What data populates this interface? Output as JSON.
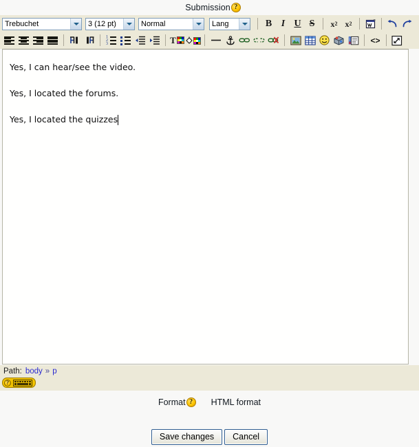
{
  "page": {
    "submission_label": "Submission",
    "help_icon": "question-help-icon",
    "background_color": "#f8f8f7",
    "toolbar_color": "#ece9d8"
  },
  "editor": {
    "toolbar_row1": {
      "font_family": {
        "value": "Trebuchet",
        "name": "font-family-select"
      },
      "font_size": {
        "value": "3 (12 pt)",
        "name": "font-size-select"
      },
      "paragraph_format": {
        "value": "Normal",
        "name": "paragraph-format-select"
      },
      "language": {
        "value": "Lang",
        "name": "language-select"
      },
      "buttons": [
        {
          "name": "bold-button",
          "label": "B",
          "title": "Bold"
        },
        {
          "name": "italic-button",
          "label": "I",
          "title": "Italic"
        },
        {
          "name": "underline-button",
          "label": "U",
          "title": "Underline"
        },
        {
          "name": "strikethrough-button",
          "label": "S",
          "title": "Strikethrough"
        },
        {
          "name": "subscript-button",
          "label": "x2",
          "title": "Subscript"
        },
        {
          "name": "superscript-button",
          "label": "x2",
          "title": "Superscript"
        },
        {
          "name": "clean-word-html-button",
          "label": "",
          "title": "Clean Word HTML"
        },
        {
          "name": "undo-button",
          "label": "",
          "title": "Undo"
        },
        {
          "name": "redo-button",
          "label": "",
          "title": "Redo"
        }
      ]
    },
    "toolbar_row2": {
      "buttons": [
        {
          "name": "align-left-button",
          "title": "Align left"
        },
        {
          "name": "align-center-button",
          "title": "Align center"
        },
        {
          "name": "align-right-button",
          "title": "Align right"
        },
        {
          "name": "align-justify-button",
          "title": "Justify"
        },
        {
          "name": "direction-ltr-button",
          "title": "Left to right"
        },
        {
          "name": "direction-rtl-button",
          "title": "Right to left"
        },
        {
          "name": "numbered-list-button",
          "title": "Numbered list"
        },
        {
          "name": "bulleted-list-button",
          "title": "Bulleted list"
        },
        {
          "name": "outdent-button",
          "title": "Decrease indent"
        },
        {
          "name": "indent-button",
          "title": "Increase indent"
        },
        {
          "name": "text-color-button",
          "title": "Text colour"
        },
        {
          "name": "background-color-button",
          "title": "Background colour"
        },
        {
          "name": "horizontal-rule-button",
          "title": "Insert horizontal rule"
        },
        {
          "name": "anchor-button",
          "title": "Insert anchor"
        },
        {
          "name": "insert-link-button",
          "title": "Insert link"
        },
        {
          "name": "unlink-button",
          "title": "Unlink"
        },
        {
          "name": "prevent-autolink-button",
          "title": "Prevent automatic linking"
        },
        {
          "name": "insert-image-button",
          "title": "Insert image"
        },
        {
          "name": "insert-table-button",
          "title": "Insert table"
        },
        {
          "name": "insert-emoticon-button",
          "title": "Insert emoticon"
        },
        {
          "name": "insert-media-button",
          "title": "Insert media"
        },
        {
          "name": "paste-special-button",
          "title": "Paste"
        },
        {
          "name": "edit-html-source-button",
          "title": "Edit HTML source"
        },
        {
          "name": "fullscreen-button",
          "title": "Enlarge editor"
        }
      ]
    },
    "content": {
      "paragraphs": [
        "Yes, I can hear/see the video.",
        "Yes, I located the forums.",
        "Yes, I located the quizzes"
      ]
    },
    "path_bar": {
      "label": "Path:",
      "items": [
        "body",
        "p"
      ],
      "separator": "»"
    },
    "keyboard_help": {
      "name": "keyboard-shortcuts-help-button",
      "question_mark": "?"
    }
  },
  "form": {
    "format_label": "Format",
    "format_help_icon": "question-help-icon",
    "format_value": "HTML format",
    "save_label": "Save changes",
    "cancel_label": "Cancel"
  }
}
